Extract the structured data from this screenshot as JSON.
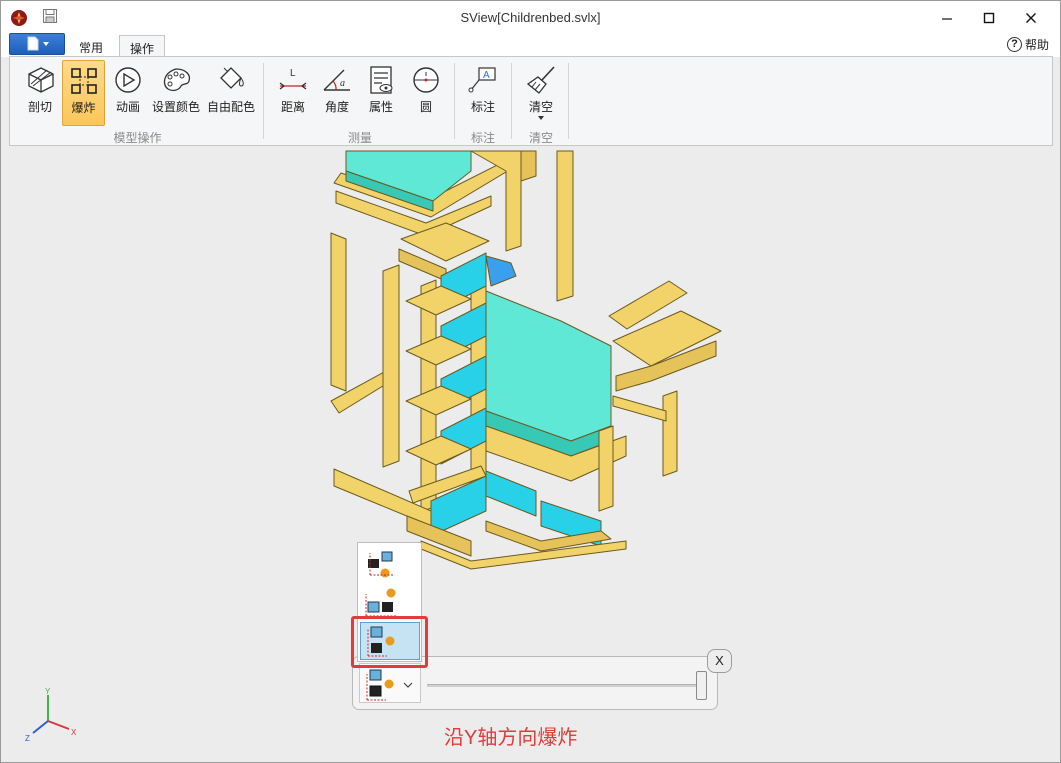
{
  "window": {
    "title": "SView[Childrenbed.svlx]",
    "minimize_glyph": "—",
    "maximize_glyph": "□",
    "close_glyph": "✕"
  },
  "tabs": [
    {
      "label": "常用",
      "active": false
    },
    {
      "label": "操作",
      "active": true
    }
  ],
  "help": {
    "icon_glyph": "?",
    "label": "帮助"
  },
  "ribbon": {
    "groups": [
      {
        "label": "模型操作",
        "buttons": [
          {
            "label": "剖切",
            "icon": "section-cube-icon"
          },
          {
            "label": "爆炸",
            "icon": "explode-icon",
            "active": true
          },
          {
            "label": "动画",
            "icon": "play-icon"
          },
          {
            "label": "设置颜色",
            "icon": "palette-icon"
          },
          {
            "label": "自由配色",
            "icon": "paint-bucket-icon"
          }
        ]
      },
      {
        "label": "测量",
        "buttons": [
          {
            "label": "距离",
            "icon": "distance-icon"
          },
          {
            "label": "角度",
            "icon": "angle-icon"
          },
          {
            "label": "属性",
            "icon": "properties-icon"
          },
          {
            "label": "圆",
            "icon": "circle-measure-icon"
          }
        ]
      },
      {
        "label": "标注",
        "buttons": [
          {
            "label": "标注",
            "icon": "annotation-icon"
          }
        ]
      },
      {
        "label": "清空",
        "buttons": [
          {
            "label": "清空",
            "icon": "broom-icon",
            "has_dropdown": true
          }
        ]
      }
    ]
  },
  "explode": {
    "close_label": "X",
    "options": [
      {
        "icon": "explode-xyz-icon"
      },
      {
        "icon": "explode-x-icon"
      },
      {
        "icon": "explode-y-icon",
        "selected": true
      },
      {
        "icon": "explode-z-icon"
      }
    ],
    "current_option_icon": "explode-z-icon",
    "slider_value": 1.0
  },
  "axis_triad": {
    "x": "X",
    "y": "Y",
    "z": "Z"
  },
  "caption": "沿Y轴方向爆炸",
  "colors": {
    "accent_active": "#fcc65a",
    "model_wood": "#f1d36a",
    "model_mattress": "#5fe8d6",
    "drawer_cyan": "#28d1e8",
    "highlight_red": "#e23b3b"
  }
}
